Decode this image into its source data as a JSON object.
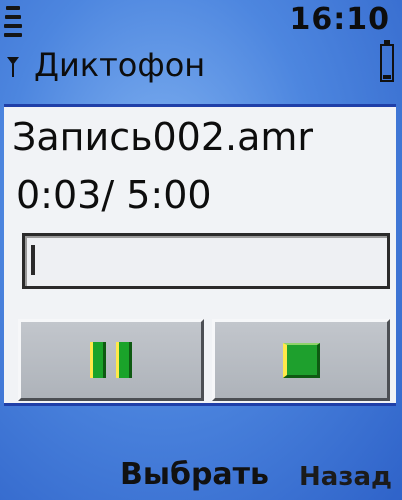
{
  "status": {
    "time": "16:10"
  },
  "app": {
    "title": "Диктофон"
  },
  "recording": {
    "filename": "Запись002.amr",
    "time_display": "0:03/ 5:00",
    "progress_fraction": 0.01
  },
  "controls": {
    "pause_icon": "pause-icon",
    "stop_icon": "stop-icon",
    "accent_green": "#1aa32a"
  },
  "softkeys": {
    "left": "Выбрать",
    "right": "Назад"
  }
}
